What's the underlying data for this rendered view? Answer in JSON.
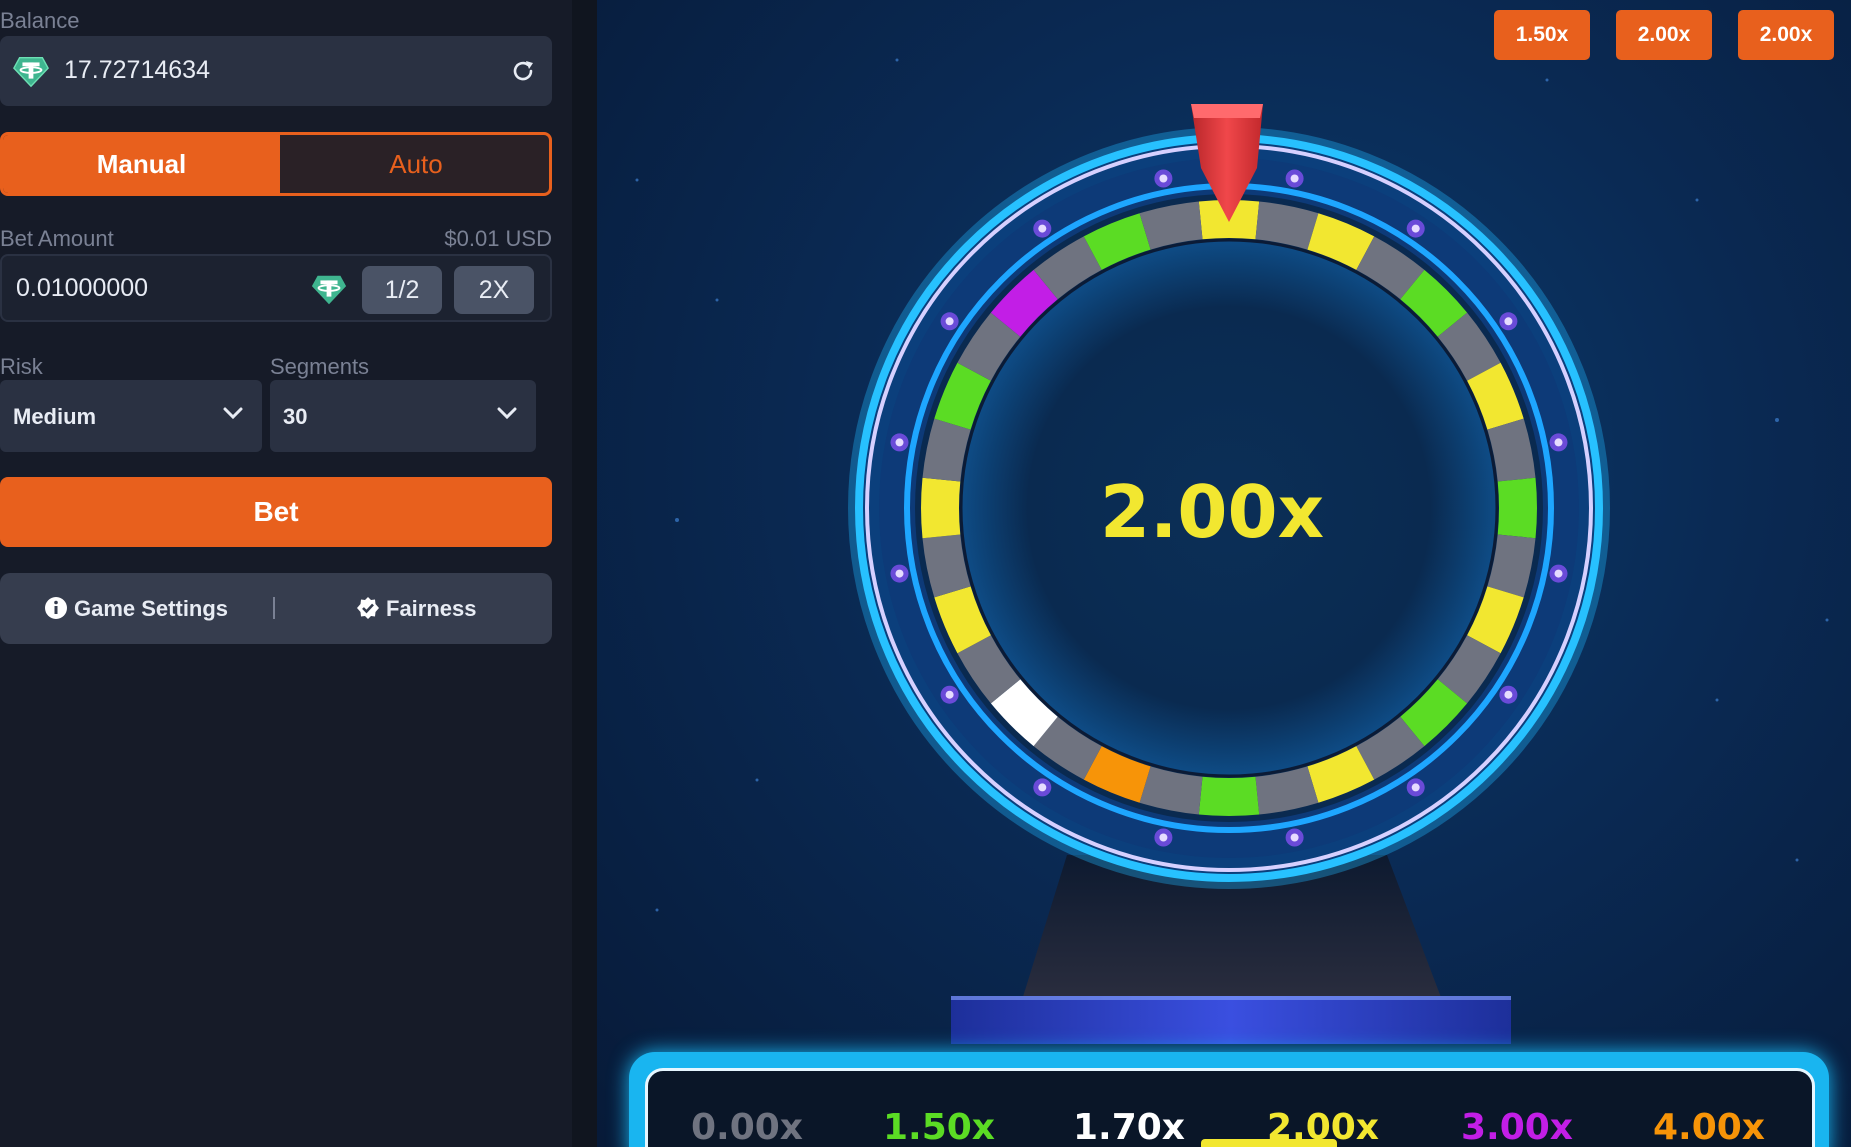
{
  "sidebar": {
    "balance_label": "Balance",
    "balance_value": "17.72714634",
    "mode_tabs": {
      "manual": "Manual",
      "auto": "Auto"
    },
    "bet_amount_label": "Bet Amount",
    "bet_amount_usd": "$0.01 USD",
    "bet_amount_value": "0.01000000",
    "half_label": "1/2",
    "double_label": "2X",
    "risk_label": "Risk",
    "risk_value": "Medium",
    "segments_label": "Segments",
    "segments_value": "30",
    "bet_button": "Bet",
    "game_settings": "Game Settings",
    "fairness": "Fairness"
  },
  "history_chips": [
    "1.50x",
    "2.00x",
    "2.00x"
  ],
  "wheel": {
    "result": "2.00x",
    "segments": [
      "yellow",
      "gray",
      "yellow",
      "gray",
      "green",
      "gray",
      "yellow",
      "gray",
      "green",
      "gray",
      "yellow",
      "gray",
      "green",
      "gray",
      "yellow",
      "gray",
      "green",
      "gray",
      "orange",
      "gray",
      "white",
      "gray",
      "yellow",
      "gray",
      "yellow",
      "gray",
      "green",
      "gray",
      "purple",
      "gray",
      "green",
      "gray"
    ]
  },
  "legend": [
    {
      "label": "0.00x",
      "color": "#6f7380"
    },
    {
      "label": "1.50x",
      "color": "#5bdc24"
    },
    {
      "label": "1.70x",
      "color": "#ffffff"
    },
    {
      "label": "2.00x",
      "color": "#f2e730"
    },
    {
      "label": "3.00x",
      "color": "#c21ee6"
    },
    {
      "label": "4.00x",
      "color": "#f79408"
    }
  ],
  "colors": {
    "accent": "#e8601d",
    "yellow": "#f2e730",
    "green": "#5bdc24",
    "gray": "#6f7380",
    "purple": "#c21ee6",
    "orange": "#f79408",
    "white": "#ffffff"
  }
}
